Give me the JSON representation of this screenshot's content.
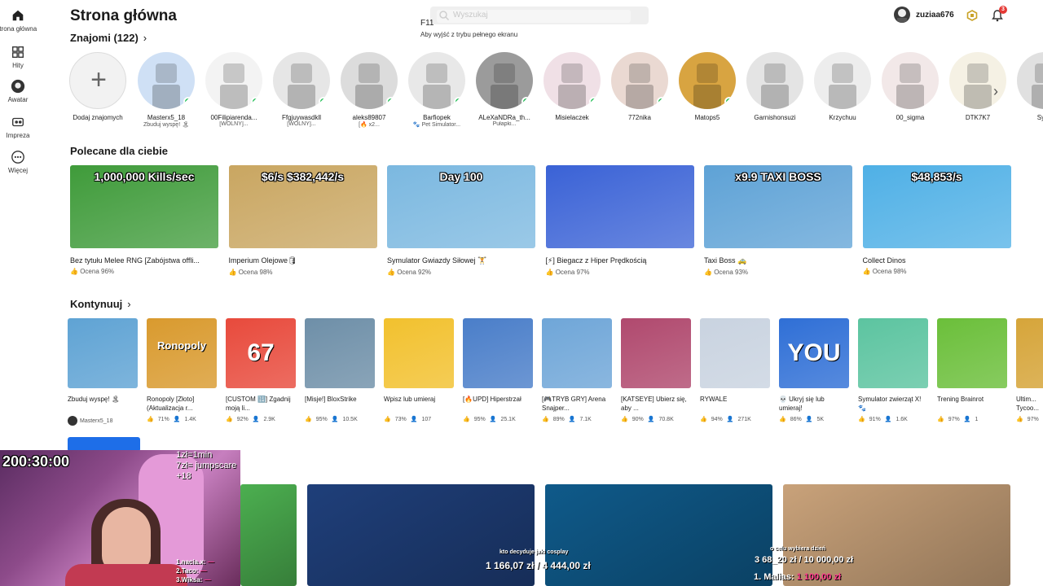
{
  "sidebar": {
    "items": [
      {
        "label": "Strona główna",
        "icon": "home-icon",
        "active": true
      },
      {
        "label": "Hity",
        "icon": "charts-icon"
      },
      {
        "label": "Awatar",
        "icon": "avatar-icon"
      },
      {
        "label": "Impreza",
        "icon": "party-icon"
      },
      {
        "label": "Więcej",
        "icon": "more-icon"
      }
    ]
  },
  "header": {
    "title": "Strona główna",
    "search_placeholder": "Wyszukaj",
    "fullscreen_key": "F11",
    "fullscreen_note": "Aby wyjść z trybu pełnego ekranu",
    "username": "zuziaa676",
    "notification_count": "3"
  },
  "friends": {
    "heading": "Znajomi (122)",
    "add_label": "Dodaj znajomych",
    "items": [
      {
        "name": "Masterx5_18",
        "status": "Zbuduj wyspę! 🏝",
        "online": true,
        "color": "#cfe0f5"
      },
      {
        "name": "00Filipiarenda...",
        "status": "[WOLNY]...",
        "online": true,
        "color": "#f3f3f3"
      },
      {
        "name": "Ffgjuywasdkll",
        "status": "[WOLNY]...",
        "online": true,
        "color": "#e6e6e6"
      },
      {
        "name": "aleks89807",
        "status": "[🔥 x2...",
        "online": true,
        "color": "#dcdcdc"
      },
      {
        "name": "Barfiopek",
        "status": "🐾 Pet Simulator...",
        "online": true,
        "color": "#e8e8e8"
      },
      {
        "name": "ALeXaNDRa_th...",
        "status": "Pułapki...",
        "online": true,
        "color": "#9b9b9b"
      },
      {
        "name": "Misielaczek",
        "status": "",
        "online": true,
        "color": "#f0e0e6"
      },
      {
        "name": "772nika",
        "status": "",
        "online": true,
        "color": "#ead9d2"
      },
      {
        "name": "Matops5",
        "status": "",
        "online": true,
        "color": "#d8a441"
      },
      {
        "name": "Garnishonsuzi",
        "status": "",
        "online": false,
        "color": "#e4e4e4"
      },
      {
        "name": "Krzychuu",
        "status": "",
        "online": false,
        "color": "#ededed"
      },
      {
        "name": "00_sigma",
        "status": "",
        "online": false,
        "color": "#f2e8e8"
      },
      {
        "name": "DTK7K7",
        "status": "",
        "online": false,
        "color": "#f5f1e4"
      },
      {
        "name": "Syn...",
        "status": "",
        "online": false,
        "color": "#e0e0e0"
      }
    ]
  },
  "recommended": {
    "heading": "Polecane dla ciebie",
    "items": [
      {
        "name": "Bez tytułu Melee RNG [Zabójstwa offli...",
        "rating": "Ocena 96%",
        "caption": "1,000,000 Kills/sec",
        "bg": "#3f9b3a"
      },
      {
        "name": "Imperium Olejowe🛢",
        "rating": "Ocena 98%",
        "caption": "$6/s  $382,442/s",
        "bg": "#c9a661"
      },
      {
        "name": "Symulator Gwiazdy Siłowej 🏋",
        "rating": "Ocena 92%",
        "caption": "Day 100",
        "bg": "#7bb8e0"
      },
      {
        "name": "[⚡] Biegacz z Hiper Prędkością",
        "rating": "Ocena 97%",
        "caption": "",
        "bg": "#3a62d6"
      },
      {
        "name": "Taxi Boss 🚕",
        "rating": "Ocena 93%",
        "caption": "x9.9 TAXI BOSS",
        "bg": "#5ea2d6"
      },
      {
        "name": "Collect Dinos",
        "rating": "Ocena 98%",
        "caption": "$48,853/s",
        "bg": "#4fb0e6"
      }
    ]
  },
  "continue": {
    "heading": "Kontynuuj",
    "items": [
      {
        "name": "Zbuduj wyspę! 🏝",
        "creator": "Masterx5_18",
        "likes": "",
        "players": "",
        "bg": "#5fa3d4",
        "caption": ""
      },
      {
        "name": "Ronopoly [Złoto] (Aktualizacja r...",
        "likes": "71%",
        "players": "1.4K",
        "bg": "#d99a2e",
        "caption": "Ronopoly"
      },
      {
        "name": "[CUSTOM 🔢] Zgadnij moją li...",
        "likes": "92%",
        "players": "2.9K",
        "bg": "#e84a3c",
        "caption": "67"
      },
      {
        "name": "[Misje!] BloxStrike",
        "likes": "95%",
        "players": "10.5K",
        "bg": "#6e8fa8",
        "caption": ""
      },
      {
        "name": "Wpisz lub umieraj",
        "likes": "73%",
        "players": "107",
        "bg": "#f2c12e",
        "caption": ""
      },
      {
        "name": "[🔥UPD] Hiperstrzał",
        "likes": "95%",
        "players": "25.1K",
        "bg": "#4a7ec9",
        "caption": ""
      },
      {
        "name": "[🎮TRYB GRY] Arena Snajper...",
        "likes": "89%",
        "players": "7.1K",
        "bg": "#6fa6d8",
        "caption": ""
      },
      {
        "name": "[KATSEYE] Ubierz się, aby ...",
        "likes": "90%",
        "players": "70.8K",
        "bg": "#b0496e",
        "caption": ""
      },
      {
        "name": "RYWALE",
        "likes": "94%",
        "players": "271K",
        "bg": "#c9d3e0",
        "caption": ""
      },
      {
        "name": "💀 Ukryj się lub umieraj!",
        "likes": "86%",
        "players": "5K",
        "bg": "#2f6fd6",
        "caption": "YOU"
      },
      {
        "name": "Symulator zwierząt X! 🐾",
        "likes": "91%",
        "players": "1.6K",
        "bg": "#5cc4a0",
        "caption": ""
      },
      {
        "name": "Trening Brainrot",
        "likes": "97%",
        "players": "1",
        "bg": "#6bbf3a",
        "caption": ""
      },
      {
        "name": "Ultim... Tycoo...",
        "likes": "97%",
        "players": "",
        "bg": "#d6a53a",
        "caption": ""
      }
    ]
  },
  "bottom_row": [
    {
      "bg": "#4caf50"
    },
    {
      "bg": "#1f3f7a"
    },
    {
      "bg": "#0f5a8a"
    },
    {
      "bg": "#c9a27a"
    }
  ],
  "stream": {
    "timer": "200:30:00",
    "rules": [
      "1zł=1min",
      "7zł= jumpscare",
      "+18"
    ],
    "leaderboard": [
      {
        "label": "1.nacia.x:",
        "amount": "—"
      },
      {
        "label": "2.Taco:",
        "amount": "—"
      },
      {
        "label": "3.Wiksa:",
        "amount": "—"
      }
    ],
    "goal_left_title": "kto decyduje jaki cosplay",
    "goal_left_value": "1 166,07 zł / 4 444,00 zł",
    "goal_right_title": "o celu wybiera dzień",
    "goal_right_value": "3 68_20 zł / 10 000,00 zł",
    "goal_right_top": "1. Malias:",
    "goal_right_amount": "1 100,00 zł"
  },
  "colors": {
    "online": "#27c25a",
    "accent": "#1e6ee8",
    "badge": "#e53935"
  }
}
